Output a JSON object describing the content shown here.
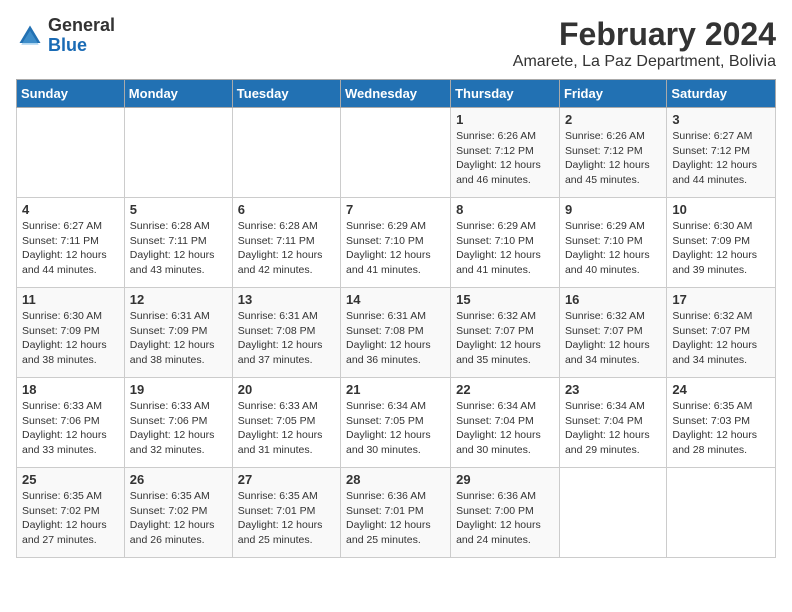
{
  "header": {
    "logo_general": "General",
    "logo_blue": "Blue",
    "month_year": "February 2024",
    "location": "Amarete, La Paz Department, Bolivia"
  },
  "days_of_week": [
    "Sunday",
    "Monday",
    "Tuesday",
    "Wednesday",
    "Thursday",
    "Friday",
    "Saturday"
  ],
  "weeks": [
    [
      {
        "day": "",
        "info": ""
      },
      {
        "day": "",
        "info": ""
      },
      {
        "day": "",
        "info": ""
      },
      {
        "day": "",
        "info": ""
      },
      {
        "day": "1",
        "info": "Sunrise: 6:26 AM\nSunset: 7:12 PM\nDaylight: 12 hours and 46 minutes."
      },
      {
        "day": "2",
        "info": "Sunrise: 6:26 AM\nSunset: 7:12 PM\nDaylight: 12 hours and 45 minutes."
      },
      {
        "day": "3",
        "info": "Sunrise: 6:27 AM\nSunset: 7:12 PM\nDaylight: 12 hours and 44 minutes."
      }
    ],
    [
      {
        "day": "4",
        "info": "Sunrise: 6:27 AM\nSunset: 7:11 PM\nDaylight: 12 hours and 44 minutes."
      },
      {
        "day": "5",
        "info": "Sunrise: 6:28 AM\nSunset: 7:11 PM\nDaylight: 12 hours and 43 minutes."
      },
      {
        "day": "6",
        "info": "Sunrise: 6:28 AM\nSunset: 7:11 PM\nDaylight: 12 hours and 42 minutes."
      },
      {
        "day": "7",
        "info": "Sunrise: 6:29 AM\nSunset: 7:10 PM\nDaylight: 12 hours and 41 minutes."
      },
      {
        "day": "8",
        "info": "Sunrise: 6:29 AM\nSunset: 7:10 PM\nDaylight: 12 hours and 41 minutes."
      },
      {
        "day": "9",
        "info": "Sunrise: 6:29 AM\nSunset: 7:10 PM\nDaylight: 12 hours and 40 minutes."
      },
      {
        "day": "10",
        "info": "Sunrise: 6:30 AM\nSunset: 7:09 PM\nDaylight: 12 hours and 39 minutes."
      }
    ],
    [
      {
        "day": "11",
        "info": "Sunrise: 6:30 AM\nSunset: 7:09 PM\nDaylight: 12 hours and 38 minutes."
      },
      {
        "day": "12",
        "info": "Sunrise: 6:31 AM\nSunset: 7:09 PM\nDaylight: 12 hours and 38 minutes."
      },
      {
        "day": "13",
        "info": "Sunrise: 6:31 AM\nSunset: 7:08 PM\nDaylight: 12 hours and 37 minutes."
      },
      {
        "day": "14",
        "info": "Sunrise: 6:31 AM\nSunset: 7:08 PM\nDaylight: 12 hours and 36 minutes."
      },
      {
        "day": "15",
        "info": "Sunrise: 6:32 AM\nSunset: 7:07 PM\nDaylight: 12 hours and 35 minutes."
      },
      {
        "day": "16",
        "info": "Sunrise: 6:32 AM\nSunset: 7:07 PM\nDaylight: 12 hours and 34 minutes."
      },
      {
        "day": "17",
        "info": "Sunrise: 6:32 AM\nSunset: 7:07 PM\nDaylight: 12 hours and 34 minutes."
      }
    ],
    [
      {
        "day": "18",
        "info": "Sunrise: 6:33 AM\nSunset: 7:06 PM\nDaylight: 12 hours and 33 minutes."
      },
      {
        "day": "19",
        "info": "Sunrise: 6:33 AM\nSunset: 7:06 PM\nDaylight: 12 hours and 32 minutes."
      },
      {
        "day": "20",
        "info": "Sunrise: 6:33 AM\nSunset: 7:05 PM\nDaylight: 12 hours and 31 minutes."
      },
      {
        "day": "21",
        "info": "Sunrise: 6:34 AM\nSunset: 7:05 PM\nDaylight: 12 hours and 30 minutes."
      },
      {
        "day": "22",
        "info": "Sunrise: 6:34 AM\nSunset: 7:04 PM\nDaylight: 12 hours and 30 minutes."
      },
      {
        "day": "23",
        "info": "Sunrise: 6:34 AM\nSunset: 7:04 PM\nDaylight: 12 hours and 29 minutes."
      },
      {
        "day": "24",
        "info": "Sunrise: 6:35 AM\nSunset: 7:03 PM\nDaylight: 12 hours and 28 minutes."
      }
    ],
    [
      {
        "day": "25",
        "info": "Sunrise: 6:35 AM\nSunset: 7:02 PM\nDaylight: 12 hours and 27 minutes."
      },
      {
        "day": "26",
        "info": "Sunrise: 6:35 AM\nSunset: 7:02 PM\nDaylight: 12 hours and 26 minutes."
      },
      {
        "day": "27",
        "info": "Sunrise: 6:35 AM\nSunset: 7:01 PM\nDaylight: 12 hours and 25 minutes."
      },
      {
        "day": "28",
        "info": "Sunrise: 6:36 AM\nSunset: 7:01 PM\nDaylight: 12 hours and 25 minutes."
      },
      {
        "day": "29",
        "info": "Sunrise: 6:36 AM\nSunset: 7:00 PM\nDaylight: 12 hours and 24 minutes."
      },
      {
        "day": "",
        "info": ""
      },
      {
        "day": "",
        "info": ""
      }
    ]
  ]
}
